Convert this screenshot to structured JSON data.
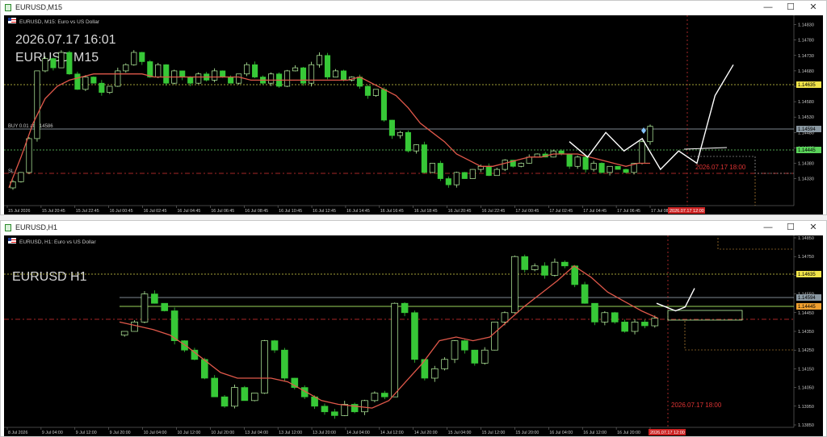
{
  "windows": [
    {
      "title": "EURUSD,M15",
      "symbol_desc": "EURUSD, M15:  Euro vs US Dollar",
      "overlay_time": "2026.07.17 16:01",
      "overlay_symbol": "EURUSD M15",
      "buy_label": "BUY 0.01 at 1.14586",
      "sl_label": "SL",
      "future_label": "2026.07.17 18:00",
      "current_time_badge": "2026.07.17 12:00",
      "price_ticks": [
        "1.14830",
        "1.14780",
        "1.14730",
        "1.14680",
        "1.14630",
        "1.14580",
        "1.14530",
        "1.14480",
        "1.14430",
        "1.14380",
        "1.14330"
      ],
      "price_badges": {
        "top_yellow": "1.14635",
        "buy_line": "1.14594",
        "bid_green": "1.14445"
      },
      "time_ticks": [
        "15 Jul 2026",
        "15 Jul 20:45",
        "15 Jul 22:45",
        "16 Jul 00:45",
        "16 Jul 02:45",
        "16 Jul 04:45",
        "16 Jul 06:45",
        "16 Jul 08:45",
        "16 Jul 10:45",
        "16 Jul 12:45",
        "16 Jul 14:45",
        "16 Jul 16:45",
        "16 Jul 18:45",
        "16 Jul 20:45",
        "16 Jul 22:45",
        "17 Jul 00:45",
        "17 Jul 02:45",
        "17 Jul 04:45",
        "17 Jul 06:45",
        "17 Jul 08:45"
      ]
    },
    {
      "title": "EURUSD,H1",
      "symbol_desc": "EURUSD, H1:  Euro vs US Dollar",
      "overlay_symbol": "EURUSD H1",
      "future_label": "2026.07.17 18:00",
      "current_time_badge": "2026.07.17 12:00",
      "price_ticks": [
        "1.14850",
        "1.14750",
        "1.14650",
        "1.14550",
        "1.14450",
        "1.14350",
        "1.14250",
        "1.14150",
        "1.14050",
        "1.13950",
        "1.13850"
      ],
      "price_badges": {
        "top_yellow": "1.14635",
        "buy_line": "1.14594",
        "bid_orange": "1.14445"
      },
      "time_ticks": [
        "8 Jul 2026",
        "9 Jul 04:00",
        "9 Jul 12:00",
        "9 Jul 20:00",
        "10 Jul 04:00",
        "10 Jul 12:00",
        "10 Jul 20:00",
        "13 Jul 04:00",
        "13 Jul 12:00",
        "13 Jul 20:00",
        "14 Jul 04:00",
        "14 Jul 12:00",
        "14 Jul 20:00",
        "15 Jul 04:00",
        "15 Jul 12:00",
        "15 Jul 20:00",
        "16 Jul 04:00",
        "16 Jul 12:00",
        "16 Jul 20:00",
        "17 Jul 04:00"
      ]
    }
  ],
  "controls": {
    "minimize": "—",
    "maximize": "☐",
    "close": "✕"
  },
  "icons": {
    "app": "chart-window-icon",
    "flag": "symbol-flag-icon"
  },
  "colors": {
    "bull": "#b9f5a2",
    "bear": "#37c837",
    "ma": "#e0584a",
    "background": "#000000",
    "projection": "#ffffff"
  },
  "chart_data": [
    {
      "type": "candlestick",
      "symbol": "EURUSD",
      "timeframe": "M15",
      "ylim": [
        1.143,
        1.1485
      ],
      "close_path": [
        1.1432,
        1.1435,
        1.1446,
        1.1468,
        1.1472,
        1.1469,
        1.1474,
        1.1467,
        1.1462,
        1.1466,
        1.1464,
        1.1461,
        1.1463,
        1.1468,
        1.147,
        1.1474,
        1.1471,
        1.1466,
        1.147,
        1.1464,
        1.1468,
        1.1466,
        1.1464,
        1.1467,
        1.1465,
        1.1468,
        1.1466,
        1.1464,
        1.1467,
        1.147,
        1.1466,
        1.1464,
        1.1467,
        1.1463,
        1.1468,
        1.1469,
        1.1464,
        1.147,
        1.1473,
        1.1466,
        1.1468,
        1.1465,
        1.1466,
        1.1463,
        1.146,
        1.1462,
        1.1452,
        1.1447,
        1.1448,
        1.1442,
        1.1444,
        1.1435,
        1.1438,
        1.1433,
        1.1431,
        1.1435,
        1.1433,
        1.1436,
        1.1437,
        1.1434,
        1.1436,
        1.1439,
        1.1437,
        1.1438,
        1.144,
        1.1441,
        1.144,
        1.1442,
        1.1441,
        1.1437,
        1.144,
        1.1436,
        1.1438,
        1.1435,
        1.1437,
        1.1436,
        1.1435,
        1.1438,
        1.1445,
        1.145
      ],
      "ma_path": [
        1.143,
        1.144,
        1.1451,
        1.1459,
        1.1463,
        1.1465,
        1.1466,
        1.1467,
        1.1467,
        1.1467,
        1.1467,
        1.1467,
        1.1466,
        1.1466,
        1.1466,
        1.1466,
        1.1466,
        1.1466,
        1.1466,
        1.1466,
        1.1465,
        1.1465,
        1.1465,
        1.1465,
        1.1465,
        1.1465,
        1.1465,
        1.1465,
        1.1465,
        1.1466,
        1.1464,
        1.1462,
        1.146,
        1.1456,
        1.1451,
        1.1448,
        1.1445,
        1.1441,
        1.1439,
        1.1437,
        1.1437,
        1.1438,
        1.1439,
        1.144,
        1.144,
        1.1441,
        1.1441,
        1.1441,
        1.144,
        1.1439,
        1.1438,
        1.1437,
        1.1438,
        1.1438
      ],
      "projection": [
        1.1445,
        1.144,
        1.1448,
        1.1442,
        1.1446,
        1.1436,
        1.1442,
        1.1438,
        1.146,
        1.147
      ],
      "lines": {
        "buy": 1.14586,
        "top": 1.14635,
        "bid": 1.14445,
        "sl": 1.1438
      }
    },
    {
      "type": "candlestick",
      "symbol": "EURUSD",
      "timeframe": "H1",
      "ylim": [
        1.1385,
        1.1485
      ],
      "close_path": [
        1.1435,
        1.144,
        1.1455,
        1.145,
        1.1446,
        1.143,
        1.1425,
        1.142,
        1.141,
        1.14,
        1.1395,
        1.1405,
        1.1398,
        1.1402,
        1.143,
        1.1425,
        1.141,
        1.1405,
        1.14,
        1.1395,
        1.1392,
        1.139,
        1.1396,
        1.1392,
        1.1398,
        1.1402,
        1.14,
        1.145,
        1.1445,
        1.142,
        1.141,
        1.1415,
        1.142,
        1.143,
        1.1425,
        1.1418,
        1.1425,
        1.144,
        1.1445,
        1.1475,
        1.1468,
        1.147,
        1.1465,
        1.1472,
        1.147,
        1.146,
        1.145,
        1.144,
        1.1445,
        1.144,
        1.1435,
        1.144,
        1.1438,
        1.1442
      ],
      "ma_path": [
        1.144,
        1.1438,
        1.1436,
        1.1433,
        1.1427,
        1.142,
        1.1413,
        1.141,
        1.141,
        1.141,
        1.1408,
        1.1403,
        1.1398,
        1.1396,
        1.1395,
        1.1394,
        1.1398,
        1.1408,
        1.1418,
        1.143,
        1.1432,
        1.143,
        1.1432,
        1.144,
        1.1448,
        1.1455,
        1.1462,
        1.147,
        1.1464,
        1.1456,
        1.1451,
        1.1446,
        1.1442
      ],
      "projection": [
        1.145,
        1.1448,
        1.1446,
        1.1448,
        1.1458
      ],
      "lines": {
        "buy": 1.14586,
        "top": 1.14635,
        "bid": 1.14445
      }
    }
  ]
}
